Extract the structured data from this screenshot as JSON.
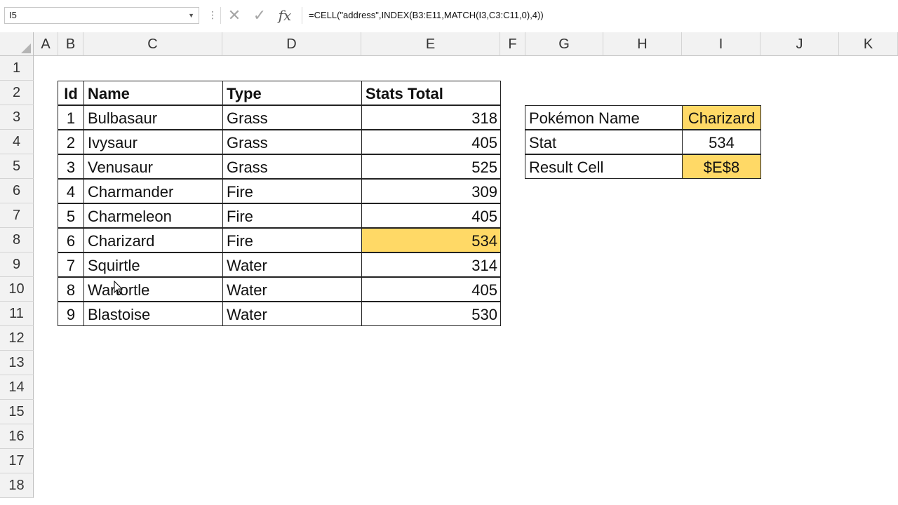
{
  "formula_bar": {
    "name_box": "I5",
    "cancel_icon": "✕",
    "enter_icon": "✓",
    "fx_label": "fx",
    "formula": "=CELL(\"address\",INDEX(B3:E11,MATCH(I3,C3:C11,0),4))"
  },
  "columns": [
    "A",
    "B",
    "C",
    "D",
    "E",
    "F",
    "G",
    "H",
    "I",
    "J",
    "K"
  ],
  "rows": [
    "1",
    "2",
    "3",
    "4",
    "5",
    "6",
    "7",
    "8",
    "9",
    "10",
    "11",
    "12",
    "13",
    "14",
    "15",
    "16",
    "17",
    "18"
  ],
  "table": {
    "headers": {
      "id": "Id",
      "name": "Name",
      "type": "Type",
      "stats": "Stats Total"
    },
    "rows": [
      {
        "id": "1",
        "name": "Bulbasaur",
        "type": "Grass",
        "stats": "318"
      },
      {
        "id": "2",
        "name": "Ivysaur",
        "type": "Grass",
        "stats": "405"
      },
      {
        "id": "3",
        "name": "Venusaur",
        "type": "Grass",
        "stats": "525"
      },
      {
        "id": "4",
        "name": "Charmander",
        "type": "Fire",
        "stats": "309"
      },
      {
        "id": "5",
        "name": "Charmeleon",
        "type": "Fire",
        "stats": "405"
      },
      {
        "id": "6",
        "name": "Charizard",
        "type": "Fire",
        "stats": "534"
      },
      {
        "id": "7",
        "name": "Squirtle",
        "type": "Water",
        "stats": "314"
      },
      {
        "id": "8",
        "name": "Wartortle",
        "type": "Water",
        "stats": "405"
      },
      {
        "id": "9",
        "name": "Blastoise",
        "type": "Water",
        "stats": "530"
      }
    ]
  },
  "lookup": {
    "name_label": "Pokémon Name",
    "name_value": "Charizard",
    "stat_label": "Stat",
    "stat_value": "534",
    "result_label": "Result Cell",
    "result_value": "$E$8"
  },
  "highlight_color": "#ffd966"
}
